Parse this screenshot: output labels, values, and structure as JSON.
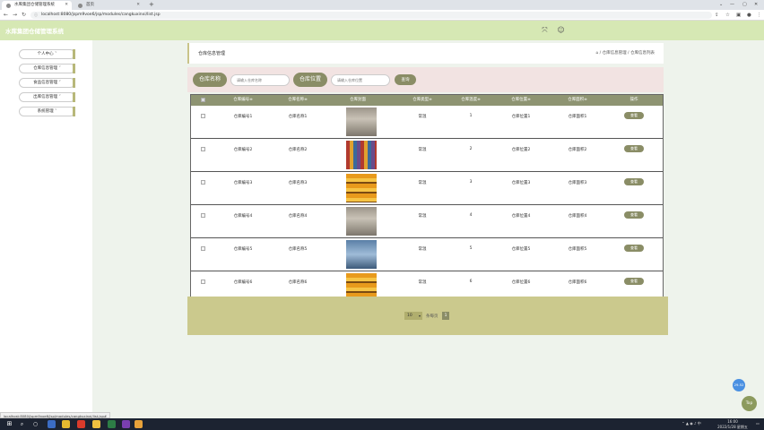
{
  "browser": {
    "tabs": [
      {
        "label": "水库集团仓储管理系统"
      },
      {
        "label": "首页"
      }
    ],
    "new_tab": "+",
    "url": "localhost:8080/jspm9voe6/jsp/modules/cangkuxinxi/list.jsp",
    "status_url": "localhost:8080/jspm9voe6/jsp/modules/cangkuxinxi/list.jsp#"
  },
  "header": {
    "title": "水库集团仓储管理系统"
  },
  "sidebar": {
    "items": [
      {
        "label": "个人中心 ˅"
      },
      {
        "label": "仓库信息管理 ˅"
      },
      {
        "label": "食品信息管理 ˅"
      },
      {
        "label": "出库信息管理 ˅"
      },
      {
        "label": "系统管理 ˅"
      }
    ]
  },
  "content": {
    "title": "仓库信息管理",
    "breadcrumb": "⌂ / 仓库信息管理 / 仓库信息列表"
  },
  "search": {
    "name_label": "仓库名称",
    "name_placeholder": "请输入仓库名称",
    "location_label": "仓库位置",
    "location_placeholder": "请输入仓库位置",
    "query_button": "查询"
  },
  "table": {
    "headers": [
      "仓库编号≑",
      "仓库名称≑",
      "仓库封面",
      "仓库类型≑",
      "仓库温度≑",
      "仓库位置≑",
      "仓库面积≑",
      "操作"
    ],
    "rows": [
      {
        "code": "仓库编号1",
        "name": "仓库名称1",
        "type": "常温",
        "temp": "1",
        "location": "仓库位置1",
        "area": "仓库面积1",
        "action": "查看",
        "img": "gray"
      },
      {
        "code": "仓库编号2",
        "name": "仓库名称2",
        "type": "常温",
        "temp": "2",
        "location": "仓库位置2",
        "area": "仓库面积2",
        "action": "查看",
        "img": "colorful"
      },
      {
        "code": "仓库编号3",
        "name": "仓库名称3",
        "type": "常温",
        "temp": "3",
        "location": "仓库位置3",
        "area": "仓库面积3",
        "action": "查看",
        "img": "orange"
      },
      {
        "code": "仓库编号4",
        "name": "仓库名称4",
        "type": "常温",
        "temp": "4",
        "location": "仓库位置4",
        "area": "仓库面积4",
        "action": "查看",
        "img": "gray"
      },
      {
        "code": "仓库编号5",
        "name": "仓库名称5",
        "type": "常温",
        "temp": "5",
        "location": "仓库位置5",
        "area": "仓库面积5",
        "action": "查看",
        "img": "blue"
      },
      {
        "code": "仓库编号6",
        "name": "仓库名称6",
        "type": "常温",
        "temp": "6",
        "location": "仓库位置6",
        "area": "仓库面积6",
        "action": "查看",
        "img": "orange"
      }
    ]
  },
  "pager": {
    "page_size": "10",
    "per_page_text": "条每页",
    "current_page": "1"
  },
  "float": {
    "badge": "29.52",
    "top": "Top"
  },
  "taskbar": {
    "time": "16:00",
    "date": "2022/1/28 星期五"
  },
  "colors": {
    "header_bg": "#d6e8b4",
    "accent": "#8a8d66",
    "pager_bg": "#cbc98d",
    "search_bg": "#f2e3e2"
  }
}
